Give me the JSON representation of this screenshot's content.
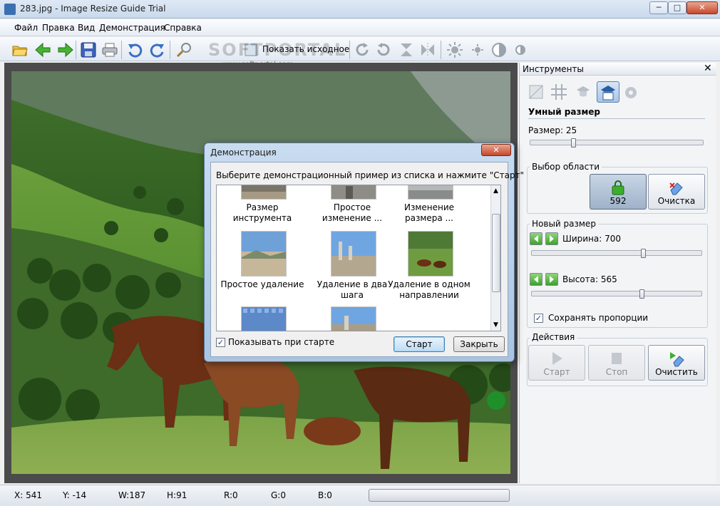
{
  "window": {
    "title": "283.jpg - Image Resize Guide Trial",
    "controls": {
      "minimize": "─",
      "maximize": "□",
      "close": "✕"
    }
  },
  "menu": [
    "Файл",
    "Правка",
    "Вид",
    "Демонстрация",
    "Справка"
  ],
  "toolbar": {
    "show_original_label": "Показать исходное",
    "icons": [
      "open-folder-icon",
      "back-arrow-icon",
      "forward-arrow-icon",
      "save-icon",
      "print-icon",
      "undo-icon",
      "redo-icon",
      "zoom-icon",
      "show-original-icon",
      "rotate-cw-icon",
      "rotate-ccw-icon",
      "flip-vertical-icon",
      "flip-horizontal-icon",
      "brightness-icon",
      "brightness-small-icon",
      "contrast-icon",
      "contrast-small-icon"
    ]
  },
  "watermark": {
    "text": "SOFTPORTAL",
    "url": "www.softportal.com"
  },
  "tools_panel": {
    "title": "Инструменты",
    "close": "✕",
    "tool_icons": [
      "crop-icon",
      "grid-icon",
      "remove-object-icon",
      "smart-resize-icon",
      "settings-gear-icon"
    ],
    "smart_size": {
      "heading": "Умный размер",
      "size_label": "Размер: 25",
      "size_value": 25
    },
    "area_selection": {
      "heading": "Выбор области",
      "lock_count": "592",
      "clear_label": "Очистка"
    },
    "new_size": {
      "heading": "Новый размер",
      "width_label": "Ширина: 700",
      "height_label": "Высота: 565",
      "keep_proportions_label": "Сохранять пропорции",
      "keep_proportions_checked": true
    },
    "actions": {
      "heading": "Действия",
      "start_label": "Старт",
      "stop_label": "Стоп",
      "clear_label": "Очистить"
    }
  },
  "dialog": {
    "title": "Демонстрация",
    "close": "✕",
    "instruction": "Выберите демонстрационный пример из списка и нажмите \"Старт\"",
    "samples": [
      {
        "label_1": "Размер",
        "label_2": "инструмента"
      },
      {
        "label_1": "Простое",
        "label_2": "изменение ..."
      },
      {
        "label_1": "Изменение",
        "label_2": "размера ..."
      },
      {
        "label_1": "Простое удаление",
        "label_2": ""
      },
      {
        "label_1": "Удаление в два",
        "label_2": "шага"
      },
      {
        "label_1": "Удаление в одном",
        "label_2": "направлении"
      }
    ],
    "show_on_start_label": "Показывать при старте",
    "show_on_start_checked": true,
    "start_button": "Старт",
    "close_button": "Закрыть"
  },
  "status": {
    "x": "X: 541",
    "y": "Y: -14",
    "w": "W:187",
    "h": "H:91",
    "r": "R:0",
    "g": "G:0",
    "b": "B:0"
  },
  "colors": {
    "accent": "#3b6fb0",
    "green_button": "#3fa12a",
    "canvas_bg": "#4b4b4b"
  }
}
